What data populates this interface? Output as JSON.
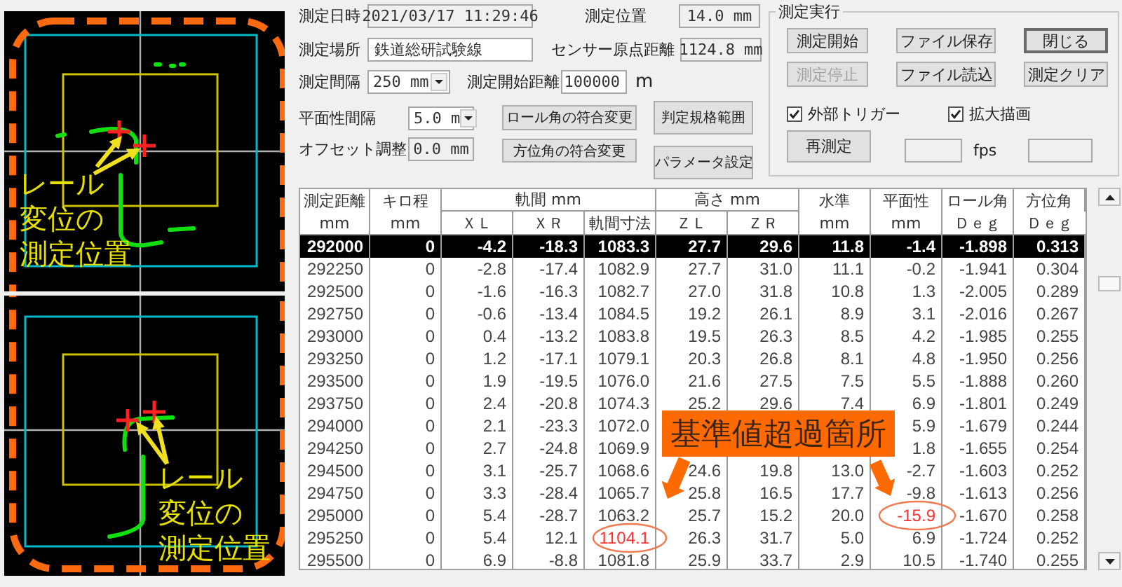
{
  "views": [
    {
      "kind": "left-caption",
      "caption": [
        "レール",
        "変位の",
        "測定位置"
      ]
    },
    {
      "kind": "right-caption",
      "caption": [
        "レール",
        "変位の",
        "測定位置"
      ]
    }
  ],
  "settings": {
    "date": {
      "label": "測定日時",
      "value": "2021/03/17 11:29:46",
      "kind": "text",
      "readonly": true
    },
    "position": {
      "label": "測定位置",
      "value": "14.0 mm",
      "kind": "text",
      "readonly": true
    },
    "location": {
      "label": "測定場所",
      "value": "鉄道総研試験線",
      "kind": "text",
      "readonly": false
    },
    "sensor_origin": {
      "label": "センサー原点距離",
      "value": "1124.8 mm",
      "kind": "text",
      "readonly": true
    },
    "interval": {
      "label": "測定間隔",
      "value": "250 mm",
      "kind": "dropdown"
    },
    "start_distance": {
      "label": "測定開始距離",
      "value": "100000",
      "unit": "m",
      "kind": "text",
      "readonly": false
    },
    "flatness_interval": {
      "label": "平面性間隔",
      "value": "5.0 m",
      "kind": "dropdown"
    },
    "offset": {
      "label": "オフセット調整",
      "value": "0.0 mm",
      "kind": "text",
      "readonly": true
    },
    "buttons": [
      {
        "label": "ロール角の符合変更"
      },
      {
        "label": "方位角の符合変更"
      },
      {
        "label": "判定規格範囲"
      },
      {
        "label": "パラメータ設定"
      }
    ]
  },
  "run_group": {
    "title": "測定実行",
    "buttons": [
      {
        "label": "測定開始",
        "disabled": false,
        "default": false
      },
      {
        "label": "ファイル保存",
        "disabled": false,
        "default": false
      },
      {
        "label": "閉じる",
        "disabled": false,
        "default": true
      },
      {
        "label": "測定停止",
        "disabled": true,
        "default": false
      },
      {
        "label": "ファイル読込",
        "disabled": false,
        "default": false
      },
      {
        "label": "測定クリア",
        "disabled": false,
        "default": false
      }
    ],
    "checkboxes": [
      {
        "label": "外部トリガー",
        "checked": true
      },
      {
        "label": "拡大描画",
        "checked": true
      }
    ],
    "remeasure": {
      "label": "再測定"
    },
    "fps_unit": "fps"
  },
  "table": {
    "header": [
      {
        "label": "測定距離",
        "unit": "mm"
      },
      {
        "label": "キロ程",
        "unit": "mm"
      },
      {
        "label": "軌間 mm",
        "columns": [
          "ＸＬ",
          "ＸＲ",
          "軌間寸法"
        ]
      },
      {
        "label": "高さ mm",
        "columns": [
          "ＺＬ",
          "ＺＲ"
        ]
      },
      {
        "label": "水準",
        "unit": "mm"
      },
      {
        "label": "平面性",
        "unit": "mm"
      },
      {
        "label": "ロール角",
        "unit": "Ｄｅｇ"
      },
      {
        "label": "方位角",
        "unit": "Ｄｅｇ"
      }
    ],
    "rows": [
      {
        "selected": true,
        "cells": [
          {
            "text": "292000",
            "over_limit": false
          },
          {
            "text": "0",
            "over_limit": false
          },
          {
            "text": "-4.2",
            "over_limit": false
          },
          {
            "text": "-18.3",
            "over_limit": false
          },
          {
            "text": "1083.3",
            "over_limit": false
          },
          {
            "text": "27.7",
            "over_limit": false
          },
          {
            "text": "29.6",
            "over_limit": false
          },
          {
            "text": "11.8",
            "over_limit": false
          },
          {
            "text": "-1.4",
            "over_limit": false
          },
          {
            "text": "-1.898",
            "over_limit": false
          },
          {
            "text": "0.313",
            "over_limit": false
          }
        ]
      },
      {
        "selected": false,
        "cells": [
          {
            "text": "292250",
            "over_limit": false
          },
          {
            "text": "0",
            "over_limit": false
          },
          {
            "text": "-2.8",
            "over_limit": false
          },
          {
            "text": "-17.4",
            "over_limit": false
          },
          {
            "text": "1082.9",
            "over_limit": false
          },
          {
            "text": "27.7",
            "over_limit": false
          },
          {
            "text": "31.0",
            "over_limit": false
          },
          {
            "text": "11.1",
            "over_limit": false
          },
          {
            "text": "-0.2",
            "over_limit": false
          },
          {
            "text": "-1.941",
            "over_limit": false
          },
          {
            "text": "0.304",
            "over_limit": false
          }
        ]
      },
      {
        "selected": false,
        "cells": [
          {
            "text": "292500",
            "over_limit": false
          },
          {
            "text": "0",
            "over_limit": false
          },
          {
            "text": "-1.6",
            "over_limit": false
          },
          {
            "text": "-16.3",
            "over_limit": false
          },
          {
            "text": "1082.7",
            "over_limit": false
          },
          {
            "text": "27.0",
            "over_limit": false
          },
          {
            "text": "31.8",
            "over_limit": false
          },
          {
            "text": "10.8",
            "over_limit": false
          },
          {
            "text": "1.3",
            "over_limit": false
          },
          {
            "text": "-2.005",
            "over_limit": false
          },
          {
            "text": "0.289",
            "over_limit": false
          }
        ]
      },
      {
        "selected": false,
        "cells": [
          {
            "text": "292750",
            "over_limit": false
          },
          {
            "text": "0",
            "over_limit": false
          },
          {
            "text": "-0.6",
            "over_limit": false
          },
          {
            "text": "-13.4",
            "over_limit": false
          },
          {
            "text": "1084.5",
            "over_limit": false
          },
          {
            "text": "19.2",
            "over_limit": false
          },
          {
            "text": "26.1",
            "over_limit": false
          },
          {
            "text": "8.9",
            "over_limit": false
          },
          {
            "text": "3.1",
            "over_limit": false
          },
          {
            "text": "-2.016",
            "over_limit": false
          },
          {
            "text": "0.267",
            "over_limit": false
          }
        ]
      },
      {
        "selected": false,
        "cells": [
          {
            "text": "293000",
            "over_limit": false
          },
          {
            "text": "0",
            "over_limit": false
          },
          {
            "text": "0.4",
            "over_limit": false
          },
          {
            "text": "-13.2",
            "over_limit": false
          },
          {
            "text": "1083.8",
            "over_limit": false
          },
          {
            "text": "19.5",
            "over_limit": false
          },
          {
            "text": "26.3",
            "over_limit": false
          },
          {
            "text": "8.5",
            "over_limit": false
          },
          {
            "text": "4.2",
            "over_limit": false
          },
          {
            "text": "-1.985",
            "over_limit": false
          },
          {
            "text": "0.255",
            "over_limit": false
          }
        ]
      },
      {
        "selected": false,
        "cells": [
          {
            "text": "293250",
            "over_limit": false
          },
          {
            "text": "0",
            "over_limit": false
          },
          {
            "text": "1.2",
            "over_limit": false
          },
          {
            "text": "-17.1",
            "over_limit": false
          },
          {
            "text": "1079.1",
            "over_limit": false
          },
          {
            "text": "20.3",
            "over_limit": false
          },
          {
            "text": "26.8",
            "over_limit": false
          },
          {
            "text": "8.1",
            "over_limit": false
          },
          {
            "text": "4.8",
            "over_limit": false
          },
          {
            "text": "-1.950",
            "over_limit": false
          },
          {
            "text": "0.256",
            "over_limit": false
          }
        ]
      },
      {
        "selected": false,
        "cells": [
          {
            "text": "293500",
            "over_limit": false
          },
          {
            "text": "0",
            "over_limit": false
          },
          {
            "text": "1.9",
            "over_limit": false
          },
          {
            "text": "-19.5",
            "over_limit": false
          },
          {
            "text": "1076.0",
            "over_limit": false
          },
          {
            "text": "21.6",
            "over_limit": false
          },
          {
            "text": "27.5",
            "over_limit": false
          },
          {
            "text": "7.5",
            "over_limit": false
          },
          {
            "text": "5.5",
            "over_limit": false
          },
          {
            "text": "-1.888",
            "over_limit": false
          },
          {
            "text": "0.260",
            "over_limit": false
          }
        ]
      },
      {
        "selected": false,
        "cells": [
          {
            "text": "293750",
            "over_limit": false
          },
          {
            "text": "0",
            "over_limit": false
          },
          {
            "text": "2.4",
            "over_limit": false
          },
          {
            "text": "-20.8",
            "over_limit": false
          },
          {
            "text": "1074.3",
            "over_limit": false
          },
          {
            "text": "25.2",
            "over_limit": false
          },
          {
            "text": "29.6",
            "over_limit": false
          },
          {
            "text": "7.4",
            "over_limit": false
          },
          {
            "text": "6.9",
            "over_limit": false
          },
          {
            "text": "-1.801",
            "over_limit": false
          },
          {
            "text": "0.249",
            "over_limit": false
          }
        ]
      },
      {
        "selected": false,
        "cells": [
          {
            "text": "294000",
            "over_limit": false
          },
          {
            "text": "0",
            "over_limit": false
          },
          {
            "text": "2.1",
            "over_limit": false
          },
          {
            "text": "-23.3",
            "over_limit": false
          },
          {
            "text": "1072.0",
            "over_limit": false
          },
          null,
          null,
          null,
          {
            "text": "5.9",
            "over_limit": false
          },
          {
            "text": "-1.679",
            "over_limit": false
          },
          {
            "text": "0.244",
            "over_limit": false
          }
        ]
      },
      {
        "selected": false,
        "cells": [
          {
            "text": "294250",
            "over_limit": false
          },
          {
            "text": "0",
            "over_limit": false
          },
          {
            "text": "2.7",
            "over_limit": false
          },
          {
            "text": "-24.8",
            "over_limit": false
          },
          {
            "text": "1069.9",
            "over_limit": false
          },
          null,
          null,
          null,
          {
            "text": "1.8",
            "over_limit": false
          },
          {
            "text": "-1.655",
            "over_limit": false
          },
          {
            "text": "0.254",
            "over_limit": false
          }
        ]
      },
      {
        "selected": false,
        "cells": [
          {
            "text": "294500",
            "over_limit": false
          },
          {
            "text": "0",
            "over_limit": false
          },
          {
            "text": "3.1",
            "over_limit": false
          },
          {
            "text": "-25.7",
            "over_limit": false
          },
          {
            "text": "1068.6",
            "over_limit": false
          },
          {
            "text": "24.6",
            "over_limit": false
          },
          {
            "text": "19.8",
            "over_limit": false
          },
          {
            "text": "13.0",
            "over_limit": false
          },
          {
            "text": "-2.7",
            "over_limit": false
          },
          {
            "text": "-1.603",
            "over_limit": false
          },
          {
            "text": "0.252",
            "over_limit": false
          }
        ]
      },
      {
        "selected": false,
        "cells": [
          {
            "text": "294750",
            "over_limit": false
          },
          {
            "text": "0",
            "over_limit": false
          },
          {
            "text": "3.3",
            "over_limit": false
          },
          {
            "text": "-28.4",
            "over_limit": false
          },
          {
            "text": "1065.7",
            "over_limit": false
          },
          {
            "text": "25.8",
            "over_limit": false
          },
          {
            "text": "16.5",
            "over_limit": false
          },
          {
            "text": "17.7",
            "over_limit": false
          },
          {
            "text": "-9.8",
            "over_limit": false
          },
          {
            "text": "-1.613",
            "over_limit": false
          },
          {
            "text": "0.256",
            "over_limit": false
          }
        ]
      },
      {
        "selected": false,
        "cells": [
          {
            "text": "295000",
            "over_limit": false
          },
          {
            "text": "0",
            "over_limit": false
          },
          {
            "text": "5.4",
            "over_limit": false
          },
          {
            "text": "-28.7",
            "over_limit": false
          },
          {
            "text": "1063.2",
            "over_limit": false
          },
          {
            "text": "25.7",
            "over_limit": false
          },
          {
            "text": "15.2",
            "over_limit": false
          },
          {
            "text": "20.0",
            "over_limit": false
          },
          {
            "text": "-15.9",
            "over_limit": true
          },
          {
            "text": "-1.670",
            "over_limit": false
          },
          {
            "text": "0.258",
            "over_limit": false
          }
        ]
      },
      {
        "selected": false,
        "cells": [
          {
            "text": "295250",
            "over_limit": false
          },
          {
            "text": "0",
            "over_limit": false
          },
          {
            "text": "5.4",
            "over_limit": false
          },
          {
            "text": "12.1",
            "over_limit": false
          },
          {
            "text": "1104.1",
            "over_limit": true
          },
          {
            "text": "26.3",
            "over_limit": false
          },
          {
            "text": "31.7",
            "over_limit": false
          },
          {
            "text": "5.0",
            "over_limit": false
          },
          {
            "text": "6.9",
            "over_limit": false
          },
          {
            "text": "-1.724",
            "over_limit": false
          },
          {
            "text": "0.252",
            "over_limit": false
          }
        ]
      },
      {
        "selected": false,
        "cells": [
          {
            "text": "295500",
            "over_limit": false
          },
          {
            "text": "0",
            "over_limit": false
          },
          {
            "text": "6.9",
            "over_limit": false
          },
          {
            "text": "-8.8",
            "over_limit": false
          },
          {
            "text": "1081.8",
            "over_limit": false
          },
          {
            "text": "25.9",
            "over_limit": false
          },
          {
            "text": "33.7",
            "over_limit": false
          },
          {
            "text": "2.9",
            "over_limit": false
          },
          {
            "text": "10.5",
            "over_limit": false
          },
          {
            "text": "-1.740",
            "over_limit": false
          },
          {
            "text": "0.255",
            "over_limit": false
          }
        ]
      }
    ],
    "callout": "基準値超過箇所"
  }
}
